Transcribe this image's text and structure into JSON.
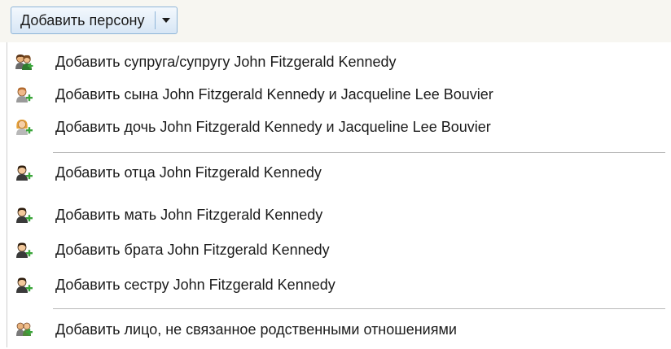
{
  "button": {
    "label": "Добавить персону",
    "arrow_icon": "caret-down-icon"
  },
  "menu": {
    "items": [
      {
        "label": "Добавить супруга/супругу John Fitzgerald Kennedy",
        "icon": "spouse-icon"
      },
      {
        "label": "Добавить сына John Fitzgerald Kennedy и Jacqueline Lee Bouvier",
        "icon": "add-son-icon"
      },
      {
        "label": "Добавить дочь John Fitzgerald Kennedy и Jacqueline Lee Bouvier",
        "icon": "add-daughter-icon"
      },
      {
        "label": "Добавить отца John Fitzgerald Kennedy",
        "icon": "add-father-icon"
      },
      {
        "label": "Добавить мать John Fitzgerald Kennedy",
        "icon": "add-mother-icon"
      },
      {
        "label": "Добавить брата John Fitzgerald Kennedy",
        "icon": "add-brother-icon"
      },
      {
        "label": "Добавить сестру John Fitzgerald Kennedy",
        "icon": "add-sister-icon"
      },
      {
        "label": "Добавить лицо, не связанное родственными отношениями",
        "icon": "add-unrelated-person-icon"
      }
    ]
  },
  "colors": {
    "button_border": "#8fb5d8",
    "plus_green": "#3aa53a",
    "separator": "#b9b9b9"
  }
}
